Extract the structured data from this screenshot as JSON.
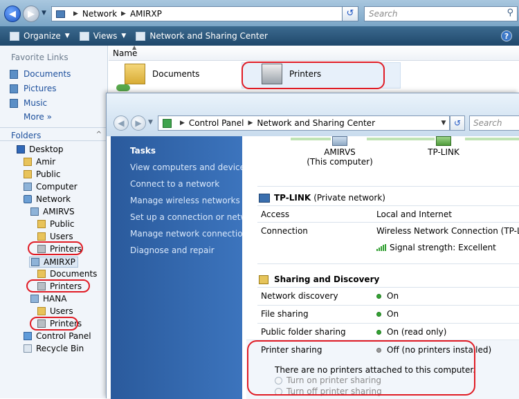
{
  "explorer": {
    "breadcrumb": [
      "Network",
      "AMIRXP"
    ],
    "search_placeholder": "Search",
    "toolbar": {
      "organize": "Organize",
      "views": "Views",
      "network_sharing": "Network and Sharing Center"
    },
    "favorite_links_title": "Favorite Links",
    "favorite_links": [
      "Documents",
      "Pictures",
      "Music"
    ],
    "more_label": "More",
    "more_chevron": "»",
    "folders_label": "Folders",
    "tree": [
      {
        "label": "Desktop",
        "icon": "desktop-icon"
      },
      {
        "label": "Amir",
        "icon": "folder-icon"
      },
      {
        "label": "Public",
        "icon": "folder-icon"
      },
      {
        "label": "Computer",
        "icon": "computer-icon"
      },
      {
        "label": "Network",
        "icon": "network-icon"
      },
      {
        "label": "AMIRVS",
        "icon": "computer-icon"
      },
      {
        "label": "Public",
        "icon": "folder-icon"
      },
      {
        "label": "Users",
        "icon": "folder-icon"
      },
      {
        "label": "Printers",
        "icon": "printer-icon"
      },
      {
        "label": "AMIRXP",
        "icon": "computer-icon"
      },
      {
        "label": "Documents",
        "icon": "folder-icon"
      },
      {
        "label": "Printers",
        "icon": "printer-icon"
      },
      {
        "label": "HANA",
        "icon": "computer-icon"
      },
      {
        "label": "Users",
        "icon": "folder-icon"
      },
      {
        "label": "Printers",
        "icon": "printer-icon"
      },
      {
        "label": "Control Panel",
        "icon": "control-panel-icon"
      },
      {
        "label": "Recycle Bin",
        "icon": "recycle-bin-icon"
      }
    ],
    "column_header": "Name",
    "items": [
      "Documents",
      "Printers"
    ]
  },
  "sharing_center": {
    "breadcrumb": [
      "Control Panel",
      "Network and Sharing Center"
    ],
    "search_placeholder": "Search",
    "tasks_title": "Tasks",
    "tasks": [
      "View computers and devices",
      "Connect to a network",
      "Manage wireless networks",
      "Set up a connection or network",
      "Manage network connections",
      "Diagnose and repair"
    ],
    "map": {
      "this_pc_name": "AMIRVS",
      "this_pc_sub": "(This computer)",
      "router": "TP-LINK"
    },
    "network": {
      "name": "TP-LINK",
      "type": "(Private network)",
      "access_label": "Access",
      "access_value": "Local and Internet",
      "connection_label": "Connection",
      "connection_value": "Wireless Network Connection (TP-LINK)",
      "signal": "Signal strength:  Excellent"
    },
    "sharing_title": "Sharing and Discovery",
    "sharing_rows": [
      {
        "label": "Network discovery",
        "value": "On",
        "status": "on"
      },
      {
        "label": "File sharing",
        "value": "On",
        "status": "on"
      },
      {
        "label": "Public folder sharing",
        "value": "On (read only)",
        "status": "on"
      },
      {
        "label": "Printer sharing",
        "value": "Off (no printers installed)",
        "status": "off"
      }
    ],
    "no_printers_msg": "There are no printers attached to this computer.",
    "radio_on": "Turn on printer sharing",
    "radio_off": "Turn off printer sharing"
  },
  "colors": {
    "annotation": "#e01b24",
    "status_on": "#33a333",
    "tasks_pane": "#2a5a9c"
  }
}
